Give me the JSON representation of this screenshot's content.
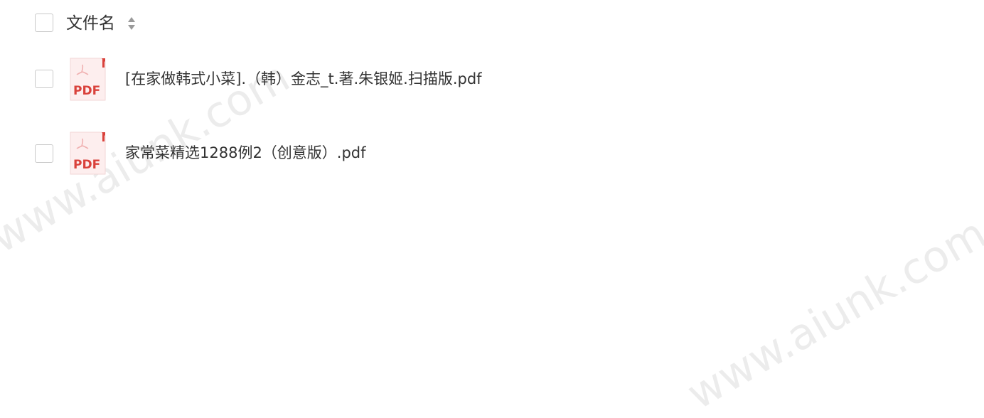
{
  "header": {
    "column_label": "文件名",
    "sort_icon": "sort-icon"
  },
  "files": [
    {
      "name": "[在家做韩式小菜].（韩）金志_t.著.朱银姬.扫描版.pdf",
      "icon": "pdf-file-icon",
      "icon_label": "PDF"
    },
    {
      "name": "家常菜精选1288例2（创意版）.pdf",
      "icon": "pdf-file-icon",
      "icon_label": "PDF"
    }
  ],
  "watermark": {
    "text_1": "www.aiunk.com",
    "text_2": "www.aiunk.com"
  },
  "colors": {
    "pdf_red": "#d9413b",
    "pdf_bg": "#fdeaea",
    "checkbox_border": "#c9c9c9",
    "text": "#333333"
  }
}
